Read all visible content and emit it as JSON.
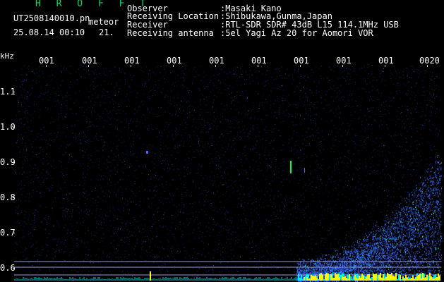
{
  "header": {
    "app_title": "H R O F F T",
    "filename": "UT2508140010.pn",
    "capture_type": "meteor",
    "datetime": "25.08.14 00:10",
    "count": "21."
  },
  "station_info": [
    {
      "label": "Observer",
      "value": ":Masaki Kano"
    },
    {
      "label": "Receiving Location",
      "value": ":Shibukawa,Gunma,Japan"
    },
    {
      "label": "Receiver",
      "value": ":RTL-SDR SDR# 43dB L15 114.1MHz USB"
    },
    {
      "label": "Receiving antenna",
      "value": ":5el Yagi Az 20 for Aomori VOR"
    }
  ],
  "spectrogram": {
    "y_unit": "kHz",
    "x_tick_labels": [
      "001",
      "001",
      "001",
      "001",
      "001",
      "001",
      "001",
      "001",
      "001",
      "0020"
    ],
    "y_tick_labels": [
      "1.1",
      "1.0",
      "0.9",
      "0.8",
      "0.7",
      "0.6"
    ],
    "colors": {
      "background": "#000000",
      "noise": "#1a2a9a",
      "noise_bright": "#3a6aff",
      "signal_hot": "#ffff00",
      "signal_warm": "#00ffff",
      "meteor": "#00ff44",
      "reference_line": "#9a9ad8",
      "text": "#ffffff",
      "title_text": "#00dd66"
    }
  }
}
